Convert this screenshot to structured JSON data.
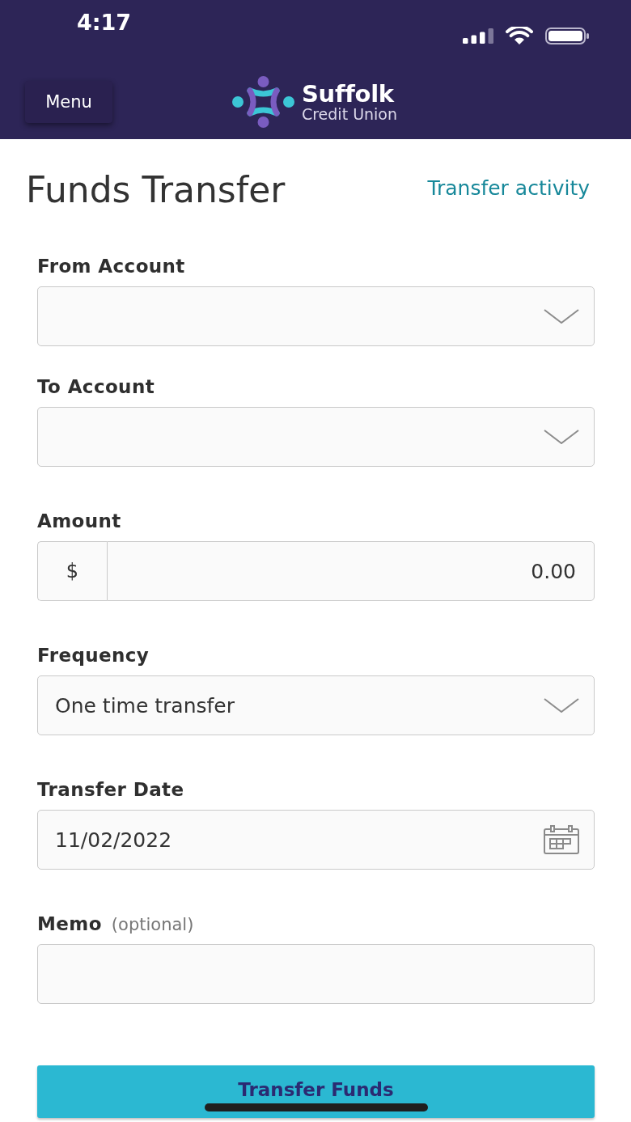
{
  "status_bar": {
    "time": "4:17"
  },
  "header": {
    "menu_button": "Menu",
    "logo": {
      "name": "Suffolk",
      "tagline": "Credit Union"
    }
  },
  "page": {
    "title": "Funds Transfer",
    "link": "Transfer activity"
  },
  "form": {
    "fields": [
      {
        "kind": "select",
        "label": "From Account"
      },
      {
        "kind": "select",
        "label": "To Account"
      },
      {
        "kind": "amount",
        "label": "Amount",
        "prefix": "$",
        "value": "0.00"
      },
      {
        "kind": "select",
        "label": "Frequency",
        "value": "One time transfer"
      },
      {
        "kind": "date",
        "label": "Transfer Date",
        "value": "11/02/2022"
      },
      {
        "kind": "text",
        "label": "Memo",
        "hint": "(optional)"
      }
    ],
    "submit_button": "Transfer Funds"
  }
}
